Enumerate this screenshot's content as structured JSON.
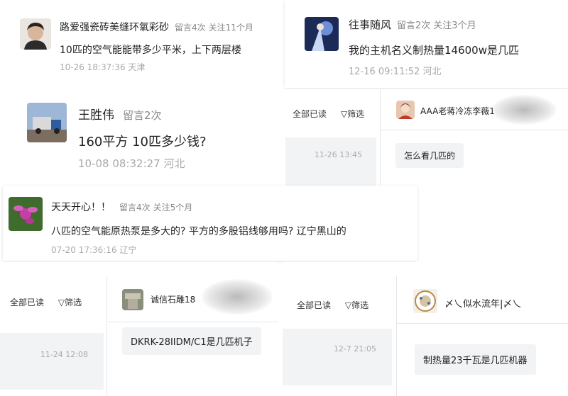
{
  "comments": [
    {
      "username": "路爱强瓷砖美缝环氧彩砂",
      "msg_count": "留言4次",
      "follow": "关注11个月",
      "message": "10匹的空气能能带多少平米，上下两层楼",
      "time": "10-26 18:37:36",
      "location": "天津"
    },
    {
      "username": "往事随风",
      "msg_count": "留言2次",
      "follow": "关注3个月",
      "message": "我的主机名义制热量14600w是几匹",
      "time": "12-16 09:11:52",
      "location": "河北"
    },
    {
      "username": "王胜伟",
      "msg_count": "留言2次",
      "message": "160平方 10匹多少钱?",
      "time": "10-08 08:32:27",
      "location": "河北"
    },
    {
      "username": "天天开心！！",
      "msg_count": "留言4次",
      "follow": "关注5个月",
      "message": "八匹的空气能原热泵是多大的? 平方的多股铝线够用吗? 辽宁黑山的",
      "time": "07-20 17:36:16",
      "location": "辽宁"
    }
  ],
  "chat_panels": [
    {
      "mark_all_read": "全部已读",
      "filter": "筛选",
      "contact": "AAA老蒋冷冻李薇1",
      "time": "11-26 13:45",
      "bubble": "怎么看几匹的"
    },
    {
      "mark_all_read": "全部已读",
      "filter": "筛选",
      "contact": "诚信石雕18",
      "time": "11-24 12:08",
      "bubble": "DKRK-28IIDM/C1是几匹机子"
    },
    {
      "mark_all_read": "全部已读",
      "filter": "筛选",
      "contact": "〆乀似水流年|〆乀",
      "time": "12-7 21:05",
      "bubble": "制热量23千瓦是几匹机器"
    }
  ],
  "icons": {
    "filter": "funnel-icon",
    "avatars": [
      "person-avatar",
      "anime-avatar",
      "truck-avatar",
      "flower-avatar",
      "portrait-avatar",
      "stone-carving-avatar",
      "plate-avatar"
    ]
  },
  "colors": {
    "text": "#222222",
    "meta": "#888888",
    "time": "#aaaaaa",
    "panel_gray": "#f2f3f5"
  }
}
